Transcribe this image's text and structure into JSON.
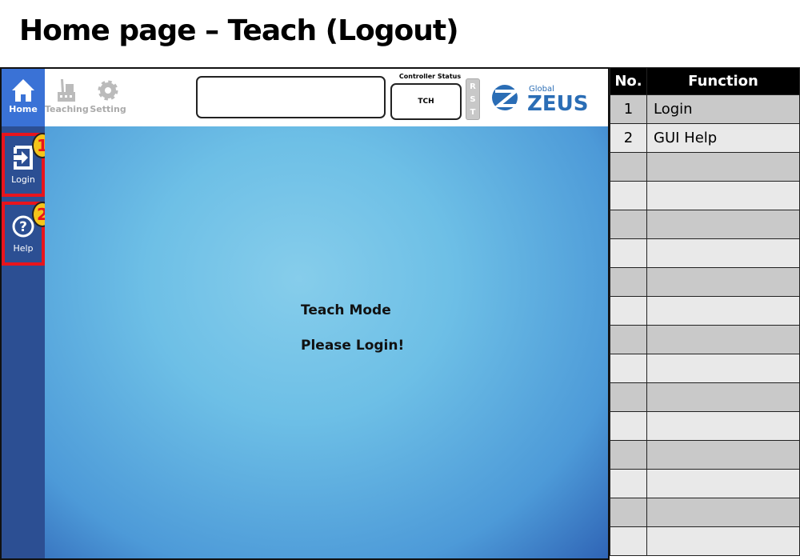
{
  "title": "Home page – Teach (Logout)",
  "topbar": {
    "nav": [
      {
        "label": "Home",
        "icon": "home-icon",
        "active": true
      },
      {
        "label": "Teaching",
        "icon": "robot-icon",
        "active": false
      },
      {
        "label": "Setting",
        "icon": "gear-icon",
        "active": false
      }
    ],
    "message": "",
    "controller_status_label": "Controller Status",
    "controller_status": "TCH",
    "rst_label": "RST",
    "logo": "Global ZEUS"
  },
  "sidebar": {
    "items": [
      {
        "label": "Login",
        "icon": "login-icon",
        "badge": "1"
      },
      {
        "label": "Help",
        "icon": "help-icon",
        "badge": "2"
      }
    ]
  },
  "main": {
    "line1": "Teach Mode",
    "line2": "Please Login!"
  },
  "table": {
    "headers": [
      "No.",
      "Function"
    ],
    "rows": [
      [
        "1",
        "Login"
      ],
      [
        "2",
        "GUI Help"
      ],
      [
        "",
        ""
      ],
      [
        "",
        ""
      ],
      [
        "",
        ""
      ],
      [
        "",
        ""
      ],
      [
        "",
        ""
      ],
      [
        "",
        ""
      ],
      [
        "",
        ""
      ],
      [
        "",
        ""
      ],
      [
        "",
        ""
      ],
      [
        "",
        ""
      ],
      [
        "",
        ""
      ],
      [
        "",
        ""
      ],
      [
        "",
        ""
      ],
      [
        "",
        ""
      ]
    ]
  },
  "colors": {
    "highlight": "#e8141c",
    "badge": "#f5c41a",
    "sidebar": "#2c4f93",
    "active_nav": "#3a72d6"
  }
}
